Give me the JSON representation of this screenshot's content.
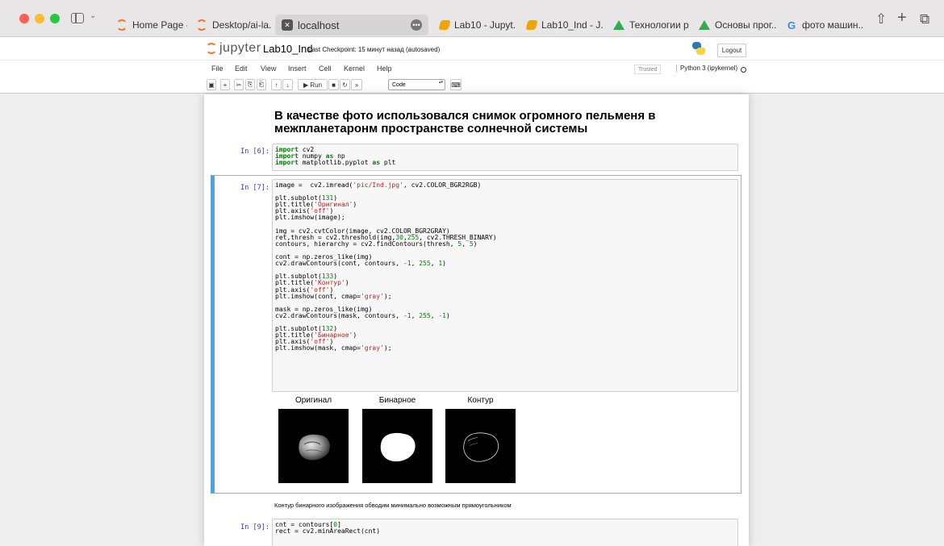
{
  "browser": {
    "tabs": [
      {
        "label": "Home Page -...",
        "icon": "jupyter-icon"
      },
      {
        "label": "Desktop/ai-la...",
        "icon": "jupyter-icon"
      },
      {
        "label": "localhost",
        "icon": "localhost-icon",
        "active": true
      },
      {
        "label": "Lab10 - Jupyt...",
        "icon": "lab-icon"
      },
      {
        "label": "Lab10_Ind - J...",
        "icon": "lab-icon"
      },
      {
        "label": "Технологии р...",
        "icon": "drive-icon"
      },
      {
        "label": "Основы прог...",
        "icon": "drive-icon"
      },
      {
        "label": "фото машин...",
        "icon": "google-icon"
      }
    ]
  },
  "header": {
    "logo_text": "jupyter",
    "notebook_title": "Lab10_Ind",
    "checkpoint": "Last Checkpoint: 15 минут назад  (autosaved)",
    "logout_label": "Logout"
  },
  "menubar": {
    "items": [
      "File",
      "Edit",
      "View",
      "Insert",
      "Cell",
      "Kernel",
      "Help"
    ],
    "trusted": "Trusted",
    "kernel": "Python 3 (ipykernel)"
  },
  "toolbar": {
    "run_label": "Run",
    "cell_type": "Code"
  },
  "notebook": {
    "heading": "В качестве фото использовался снимок огромного пельменя в межпланетаронм пространстве солнечной системы",
    "cell6_prompt": "In [6]:",
    "cell7_prompt": "In [7]:",
    "cell9_prompt": "In [9]:",
    "plot_titles": [
      "Оригинал",
      "Бинарное",
      "Контур"
    ],
    "md_text": "Контур бинарного изображения обводим минимально возможным прямоугольником"
  },
  "colors": {
    "selected_cell_bar": "#42a5f5",
    "prompt_color": "#303f9f",
    "keyword_color": "#008000",
    "string_color": "#ba2121"
  }
}
